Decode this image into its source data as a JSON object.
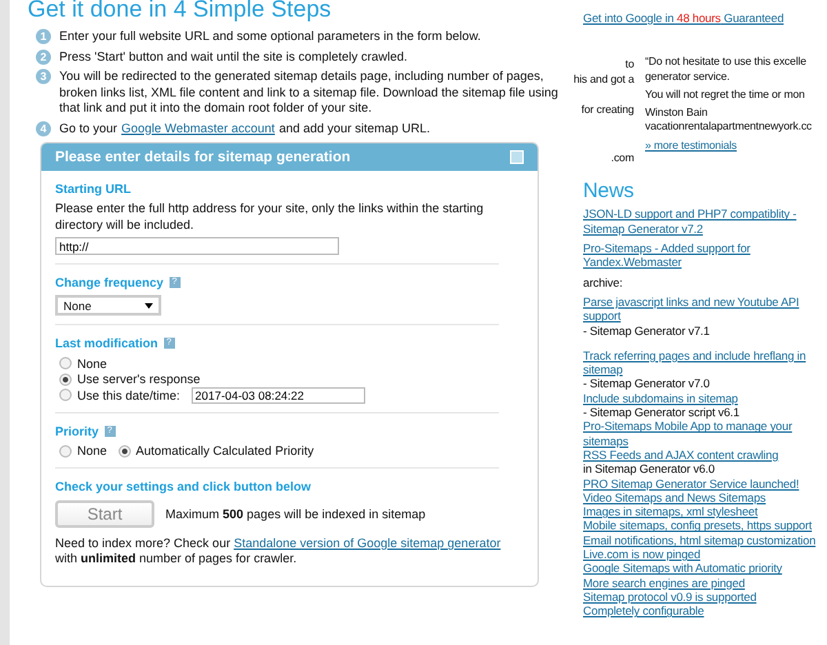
{
  "title": "Get it done in 4 Simple Steps",
  "steps": [
    {
      "number": "1",
      "text": "Enter your full website URL and some optional parameters in the form below."
    },
    {
      "number": "2",
      "text": "Press 'Start' button and wait until the site is completely crawled."
    },
    {
      "number": "3",
      "text": "You will be redirected to the generated sitemap details page, including number of pages, broken links list, XML file content and link to a sitemap file. Download the sitemap file using that link and put it into the domain root folder of your site."
    },
    {
      "number": "4",
      "before": "Go to your",
      "link": "Google Webmaster account",
      "after": "and add your sitemap URL."
    }
  ],
  "panel": {
    "title": "Please enter details for sitemap generation",
    "starting_url": {
      "label": "Starting URL",
      "description": "Please enter the full http address for your site, only the links within the starting directory will be included.",
      "value": "http://"
    },
    "change_frequency": {
      "label": "Change frequency",
      "help": "?",
      "value": "None"
    },
    "last_modification": {
      "label": "Last modification",
      "help": "?",
      "options": [
        {
          "label": "None",
          "selected": false
        },
        {
          "label": "Use server's response",
          "selected": true
        },
        {
          "label": "Use this date/time:",
          "selected": false,
          "value": "2017-04-03 08:24:22"
        }
      ]
    },
    "priority": {
      "label": "Priority",
      "help": "?",
      "options": [
        {
          "label": "None",
          "selected": false
        },
        {
          "label": "Automatically Calculated Priority",
          "selected": true
        }
      ]
    },
    "check_label": "Check your settings and click button below",
    "start_button": "Start",
    "max_note": "Maximum **500** pages will be indexed in sitemap",
    "more": {
      "before": "Need to index more? Check our",
      "link": "Standalone version of Google sitemap generator",
      "after": "with **unlimited** number of pages for crawler."
    }
  },
  "promo": {
    "before": "Get into Google in",
    "highlight": "48 hours",
    "after": "Guaranteed"
  },
  "testimonials": {
    "left_lines": [
      "to",
      "his and got a",
      "for creating",
      ".com"
    ],
    "quote_lines": [
      "“Do not hesitate to use this excelle",
      "generator service.",
      "You will not regret the time or mon"
    ],
    "author": "Winston Bain",
    "site": "vacationrentalapartmentnewyork.cc",
    "more": "» more testimonials"
  },
  "news": {
    "title": "News",
    "latest": [
      {
        "link": "JSON-LD support and PHP7 compatiblity - Sitemap Generator v7.2"
      },
      {
        "link": "Pro-Sitemaps - Added support for Yandex.Webmaster"
      }
    ],
    "archive_label": "archive:",
    "archive": [
      {
        "link": "Parse javascript links and new Youtube API support",
        "suffix": "- Sitemap Generator v7.1"
      }
    ],
    "older": [
      {
        "link": "Track referring pages and include hreflang in sitemap",
        "suffix": "- Sitemap Generator v7.0"
      },
      {
        "link": "Include subdomains in sitemap",
        "suffix": "- Sitemap Generator script v6.1"
      },
      {
        "link": "Pro-Sitemaps Mobile App to manage your sitemaps"
      },
      {
        "link": "RSS Feeds and AJAX content crawling",
        "suffix": "in Sitemap Generator v6.0"
      },
      {
        "link": "PRO Sitemap Generator Service launched!"
      },
      {
        "link": "Video Sitemaps and News Sitemaps"
      },
      {
        "link": "Images in sitemaps, xml stylesheet"
      },
      {
        "link": "Mobile sitemaps, config presets, https support"
      },
      {
        "link": "Email notifications, html sitemap customization"
      },
      {
        "link": "Live.com is now pinged"
      },
      {
        "link": "Google Sitemaps with Automatic priority"
      },
      {
        "link": "More search engines are pinged"
      },
      {
        "link": "Sitemap protocol v0.9 is supported"
      },
      {
        "link": "Completely configurable"
      }
    ]
  }
}
